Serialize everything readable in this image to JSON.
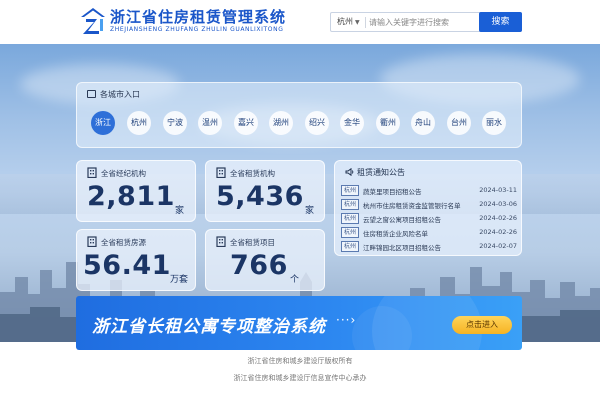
{
  "header": {
    "title": "浙江省住房租赁管理系统",
    "subtitle": "ZHEJIANSHENG ZHUFANG ZHULIN GUANLIXITONG",
    "search": {
      "city": "杭州",
      "placeholder": "请输入关键字进行搜索",
      "button": "搜索"
    }
  },
  "cities": {
    "heading": "各城市入口",
    "items": [
      "浙江",
      "杭州",
      "宁波",
      "温州",
      "嘉兴",
      "湖州",
      "绍兴",
      "金华",
      "衢州",
      "舟山",
      "台州",
      "丽水"
    ],
    "active": "浙江"
  },
  "stats": [
    {
      "label": "全省经纪机构",
      "value": "2,811",
      "unit": "家"
    },
    {
      "label": "全省租赁机构",
      "value": "5,436",
      "unit": "家"
    },
    {
      "label": "全省租赁房源",
      "value": "56.41",
      "unit": "万套"
    },
    {
      "label": "全省租赁项目",
      "value": "766",
      "unit": "个"
    }
  ],
  "notices": {
    "heading": "租赁通知公告",
    "items": [
      {
        "tag": "杭州",
        "title": "蔬菜里项目招租公告",
        "date": "2024-03-11"
      },
      {
        "tag": "杭州",
        "title": "杭州市住房租赁资金监管银行名单",
        "date": "2024-03-06"
      },
      {
        "tag": "杭州",
        "title": "云望之窗公寓项目招租公告",
        "date": "2024-02-26"
      },
      {
        "tag": "杭州",
        "title": "住房租赁企业风险名单",
        "date": "2024-02-26"
      },
      {
        "tag": "杭州",
        "title": "江畔锦园北区项目招租公告",
        "date": "2024-02-07"
      }
    ]
  },
  "banner": {
    "title": "浙江省长租公寓专项整治系统",
    "more": "···›",
    "button": "点击进入"
  },
  "footer": {
    "line1": "浙江省住房和城乡建设厅版权所有",
    "line2": "浙江省住房和城乡建设厅信息宣传中心承办"
  },
  "colors": {
    "brand": "#1a56c9",
    "search_button": "#1a5fd6",
    "active_city": "#2e6fd8",
    "banner": "#2c86f0",
    "banner_button": "#f6b323"
  }
}
